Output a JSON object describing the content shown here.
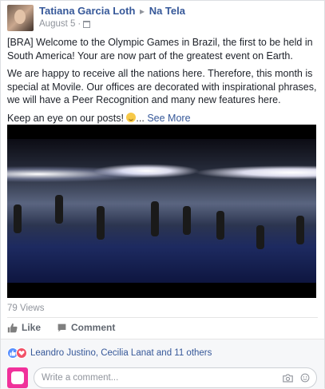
{
  "post": {
    "author": "Tatiana Garcia Loth",
    "to_word": "to",
    "group": "Na Tela",
    "date": "August 5",
    "dot": "·",
    "paragraphs": [
      "[BRA] Welcome to the Olympic Games in Brazil, the first to be held in South America! Your are now part of the greatest event on Earth.",
      "We are happy to receive all the nations here. Therefore, this month is special at Movile. Our offices are decorated with inspirational phrases, we will have a Peer Recognition and many new features here."
    ],
    "last_line": "Keep an eye on our posts! ",
    "ellipsis": "...",
    "see_more": "See More",
    "views": "79 Views"
  },
  "actions": {
    "like": "Like",
    "comment": "Comment"
  },
  "reactions": {
    "summary": "Leandro Justino, Cecilia Lanat and 11 others"
  },
  "comment_box": {
    "placeholder": "Write a comment..."
  },
  "icons": [
    "calendar-icon",
    "smile-emoji-icon",
    "like-thumb-icon",
    "comment-bubble-icon",
    "like-reaction-icon",
    "love-reaction-icon",
    "camera-icon",
    "emoji-icon"
  ],
  "colors": {
    "link": "#365899",
    "like_reaction": "#5890ff",
    "love_reaction": "#f25268",
    "comment_avatar": "#f0319b"
  }
}
